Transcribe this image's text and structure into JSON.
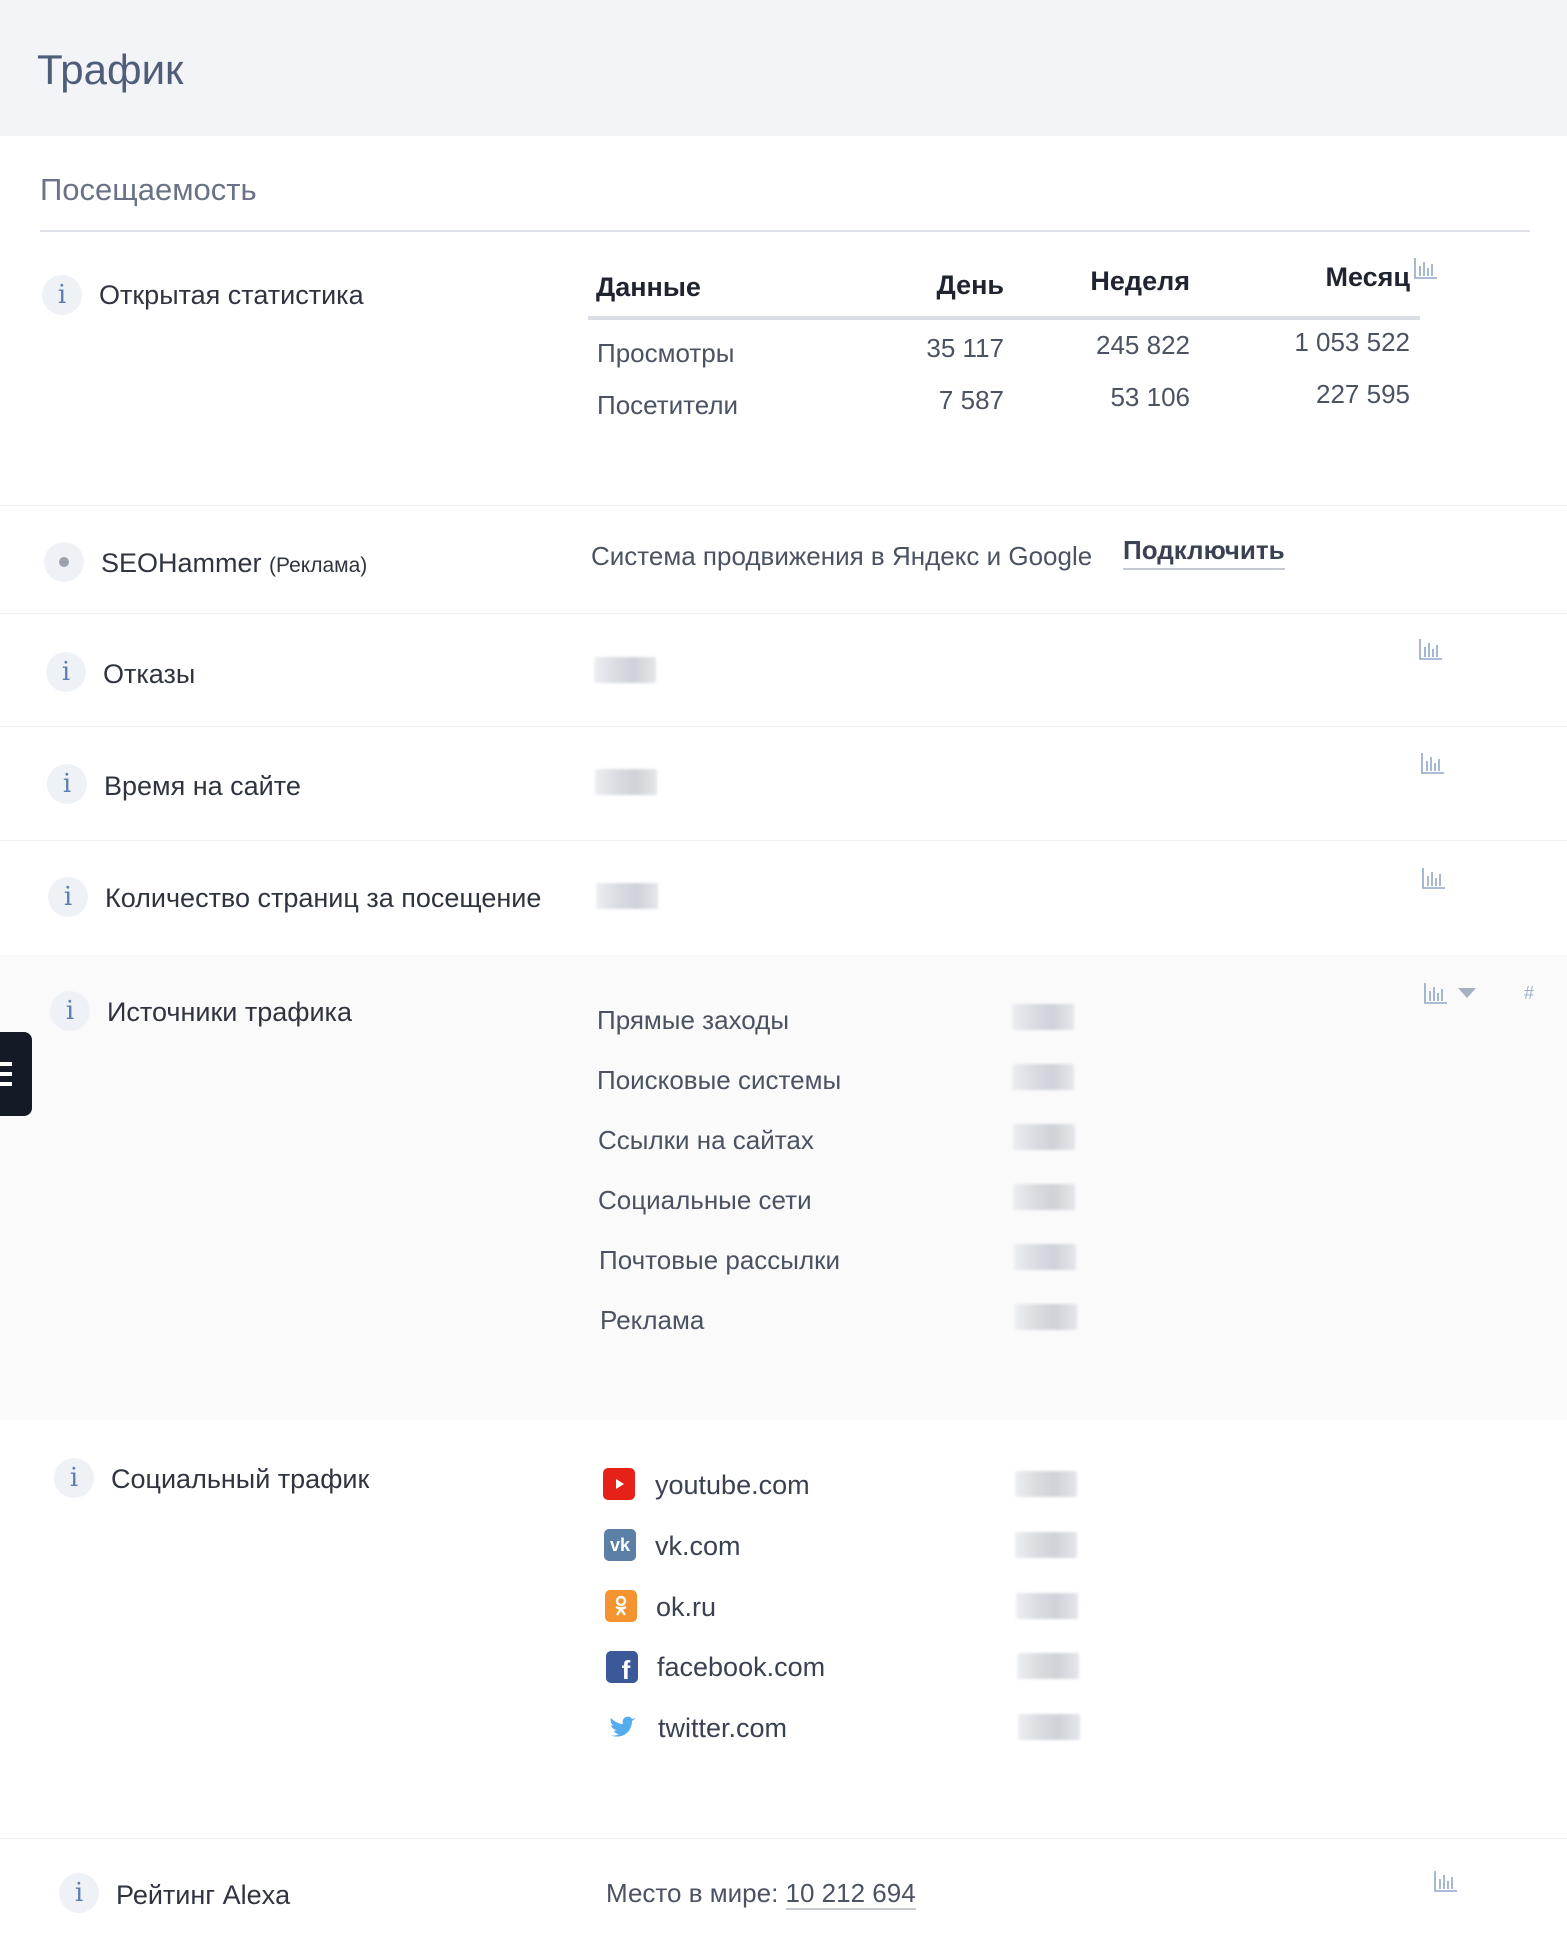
{
  "header": {
    "title": "Трафик"
  },
  "section": {
    "title": "Посещаемость"
  },
  "open_stats": {
    "label": "Открытая статистика",
    "columns": [
      "Данные",
      "День",
      "Неделя",
      "Месяц"
    ],
    "rows": [
      {
        "name": "Просмотры",
        "day": "35 117",
        "week": "245 822",
        "month": "1 053 522"
      },
      {
        "name": "Посетители",
        "day": "7 587",
        "week": "53 106",
        "month": "227 595"
      }
    ]
  },
  "seohammer": {
    "label": "SEOHammer",
    "ad_note": "(Реклама)",
    "description": "Система продвижения в Яндекс и Google",
    "connect_label": "Подключить"
  },
  "metrics": [
    {
      "label": "Отказы"
    },
    {
      "label": "Время на сайте"
    },
    {
      "label": "Количество страниц за посещение"
    }
  ],
  "traffic_sources": {
    "label": "Источники трафика",
    "items": [
      "Прямые заходы",
      "Поисковые системы",
      "Ссылки на сайтах",
      "Социальные сети",
      "Почтовые рассылки",
      "Реклама"
    ],
    "hash": "#"
  },
  "social_traffic": {
    "label": "Социальный трафик",
    "items": [
      {
        "name": "youtube.com",
        "icon": "youtube-icon",
        "color": "#e62117"
      },
      {
        "name": "vk.com",
        "icon": "vk-icon",
        "color": "#5b7fa6"
      },
      {
        "name": "ok.ru",
        "icon": "ok-icon",
        "color": "#f59331"
      },
      {
        "name": "facebook.com",
        "icon": "facebook-icon",
        "color": "#3b5998"
      },
      {
        "name": "twitter.com",
        "icon": "twitter-icon",
        "color": "#55acee"
      }
    ]
  },
  "alexa": {
    "label": "Рейтинг Alexa",
    "place_label": "Место в мире:",
    "place_value": "10 212 694"
  }
}
